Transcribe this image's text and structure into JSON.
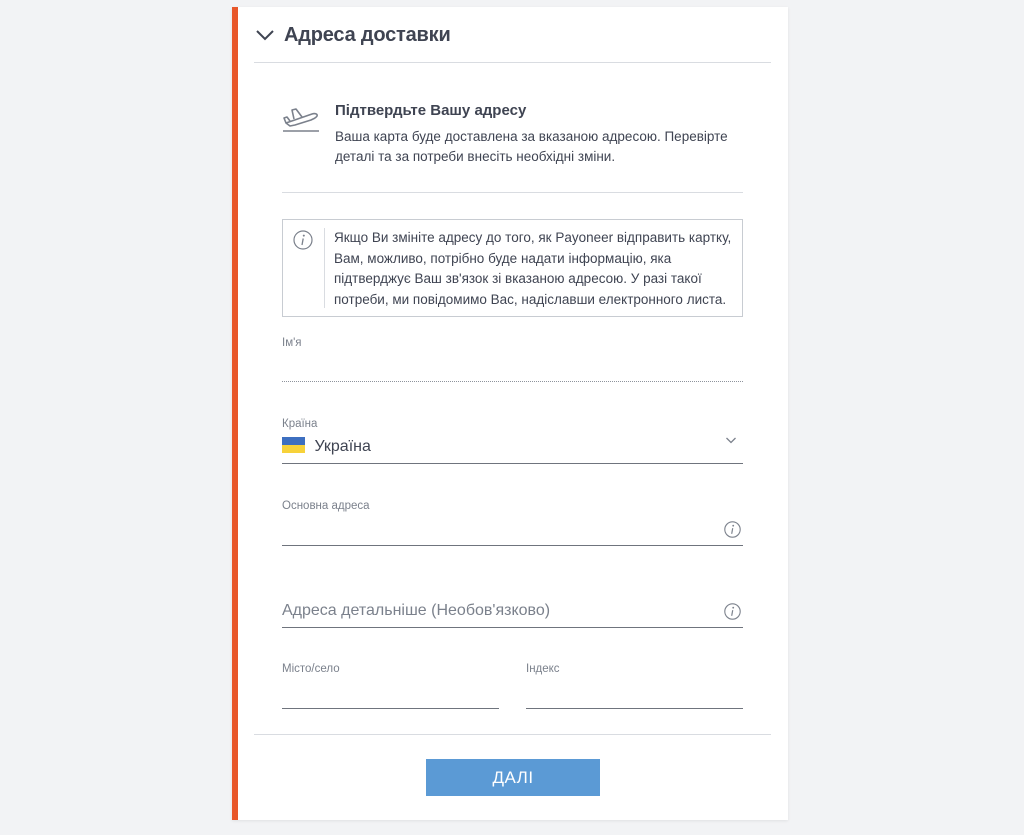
{
  "section": {
    "title": "Адреса доставки"
  },
  "confirm": {
    "title": "Підтвердьте Вашу адресу",
    "text": "Ваша карта буде доставлена за вказаною адресою. Перевірте деталі та за потреби внесіть необхідні зміни."
  },
  "info": {
    "text": "Якщо Ви змініте адресу до того, як Payoneer відправить картку, Вам, можливо, потрібно буде надати інформацію, яка підтверджує Ваш зв'язок зі вказаною адресою. У разі такої потреби, ми повідомимо Вас, надіславши електронного листа."
  },
  "form": {
    "name_label": "Ім'я",
    "name_value": "",
    "country_label": "Країна",
    "country_value": "Україна",
    "address1_label": "Основна адреса",
    "address1_value": "",
    "address2_placeholder": "Адреса детальніше (Необов'язково)",
    "city_label": "Місто/село",
    "city_value": "",
    "zip_label": "Індекс",
    "zip_value": ""
  },
  "actions": {
    "next_label": "ДАЛІ"
  },
  "colors": {
    "accent": "#e8572a",
    "button": "#5b9ad5",
    "text": "#3f4452",
    "label": "#7b818c",
    "flag_blue": "#3d6fc0",
    "flag_yellow": "#f7d23a"
  },
  "icons": {
    "section_toggle": "chevron-down-icon",
    "confirm": "airplane-icon",
    "info": "info-icon",
    "country_dropdown": "chevron-down-icon",
    "field_help": "info-icon"
  }
}
